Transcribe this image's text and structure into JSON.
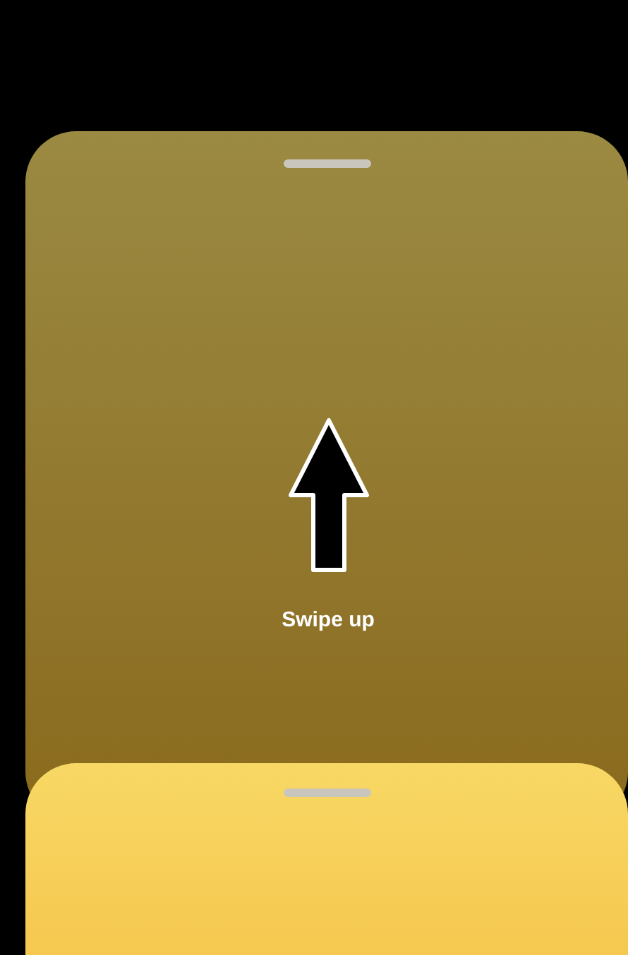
{
  "instruction": "Swipe up"
}
